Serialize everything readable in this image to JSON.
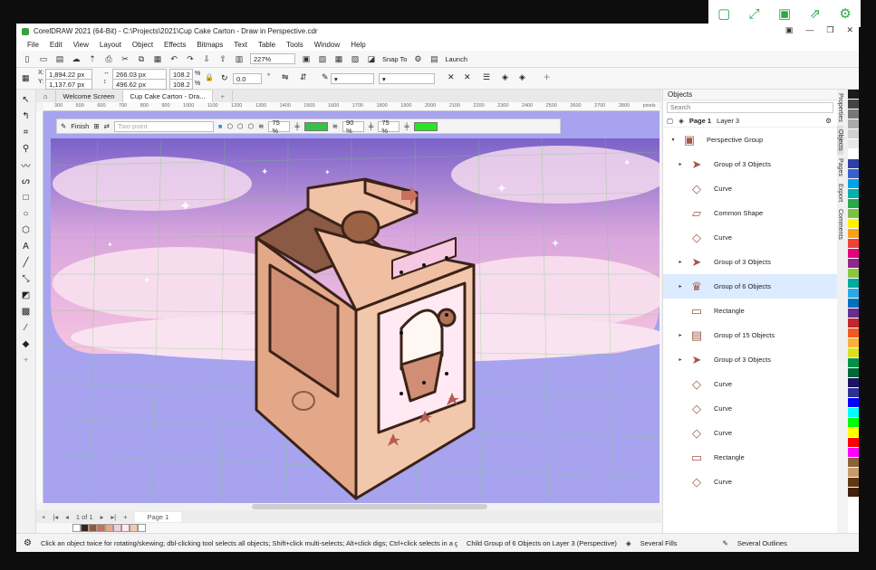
{
  "window": {
    "title": "CorelDRAW 2021 (64-Bit) - C:\\Projects\\2021\\Cup Cake Carton - Draw in Perspective.cdr"
  },
  "menu": [
    "File",
    "Edit",
    "View",
    "Layout",
    "Object",
    "Effects",
    "Bitmaps",
    "Text",
    "Table",
    "Tools",
    "Window",
    "Help"
  ],
  "toolbar": {
    "zoom": "227%",
    "snap_to": "Snap To",
    "launch": "Launch"
  },
  "props": {
    "x": "1,894.22 px",
    "y": "1,137.67 px",
    "w": "266.03 px",
    "h": "496.62 px",
    "sx": "108.2",
    "sy": "108.2",
    "sx_unit": "%",
    "sy_unit": "%",
    "angle": "0.0"
  },
  "tabs": [
    {
      "label": "Welcome Screen"
    },
    {
      "label": "Cup Cake Carton - Dra..."
    }
  ],
  "ruler_ticks": [
    "300",
    "500",
    "600",
    "700",
    "800",
    "900",
    "1000",
    "1100",
    "1200",
    "1300",
    "1400",
    "1500",
    "1600",
    "1700",
    "1800",
    "1900",
    "2000",
    "2100",
    "2200",
    "2300",
    "2400",
    "2500",
    "2600",
    "2700",
    "2800",
    "pixels"
  ],
  "perspective_toolbar": {
    "finish": "Finish",
    "mode": "Two-point",
    "opacity1": "75 %",
    "opacity2": "90 %",
    "opacity3": "75 %"
  },
  "pagenav": {
    "of": "1 of 1",
    "page": "Page 1"
  },
  "status": {
    "hint": "Click an object twice for rotating/skewing; dbl-clicking tool selects all objects; Shift+click multi-selects; Alt+click digs; Ctrl+click selects in a group",
    "selection": "Child Group of 6 Objects on Layer 3  (Perspective)",
    "fill": "Several Fills",
    "outline": "Several Outlines"
  },
  "objects_panel": {
    "title": "Objects",
    "search_placeholder": "Search",
    "page": "Page 1",
    "layer": "Layer 3",
    "items": [
      {
        "label": "Perspective Group",
        "expand": "▾",
        "selected": false
      },
      {
        "label": "Group of 3 Objects",
        "expand": "▸",
        "selected": false
      },
      {
        "label": "Curve",
        "expand": "",
        "selected": false
      },
      {
        "label": "Common Shape",
        "expand": "",
        "selected": false
      },
      {
        "label": "Curve",
        "expand": "",
        "selected": false
      },
      {
        "label": "Group of 3 Objects",
        "expand": "▸",
        "selected": false
      },
      {
        "label": "Group of 6 Objects",
        "expand": "▸",
        "selected": true
      },
      {
        "label": "Rectangle",
        "expand": "",
        "selected": false
      },
      {
        "label": "Group of 15 Objects",
        "expand": "▸",
        "selected": false
      },
      {
        "label": "Group of 3 Objects",
        "expand": "▸",
        "selected": false
      },
      {
        "label": "Curve",
        "expand": "",
        "selected": false
      },
      {
        "label": "Curve",
        "expand": "",
        "selected": false
      },
      {
        "label": "Curve",
        "expand": "",
        "selected": false
      },
      {
        "label": "Rectangle",
        "expand": "",
        "selected": false
      },
      {
        "label": "Curve",
        "expand": "",
        "selected": false
      }
    ]
  },
  "side_tabs": [
    "Properties",
    "Objects",
    "Pages",
    "Export",
    "Comments"
  ],
  "palette_colors": [
    "#1a1a1a",
    "#444444",
    "#777777",
    "#aaaaaa",
    "#d0d0d0",
    "#e8e8e8",
    "#ffffff",
    "#2f3fa6",
    "#3a5fcf",
    "#00a2e8",
    "#00b2a9",
    "#2ba84a",
    "#7cc242",
    "#fff200",
    "#f7a11a",
    "#ef4136",
    "#e6007e",
    "#92278f",
    "#8dc63f",
    "#00a99d",
    "#29abe2",
    "#0071bc",
    "#662d91",
    "#c1272d",
    "#f15a24",
    "#fbb03b",
    "#d9e021",
    "#009245",
    "#006837",
    "#1b1464",
    "#2e3192",
    "#0000ff",
    "#00ffff",
    "#00ff00",
    "#ffff00",
    "#ff0000",
    "#ff00ff",
    "#8c6239",
    "#c69c6d",
    "#603813",
    "#42210b"
  ]
}
